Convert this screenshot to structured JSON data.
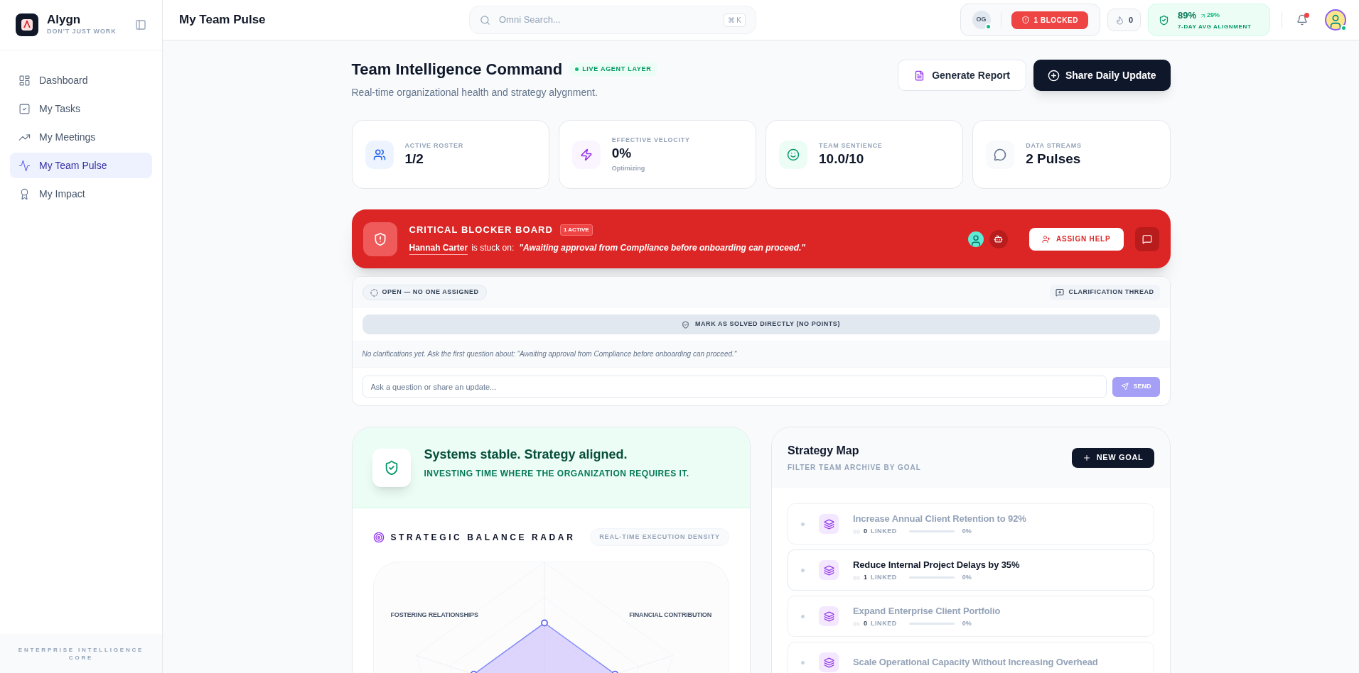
{
  "brand": {
    "name": "Alygn",
    "tagline": "DON'T JUST WORK"
  },
  "sidebar": {
    "items": [
      {
        "label": "Dashboard",
        "selected": false
      },
      {
        "label": "My Tasks",
        "selected": false
      },
      {
        "label": "My Meetings",
        "selected": false
      },
      {
        "label": "My Team Pulse",
        "selected": true
      },
      {
        "label": "My Impact",
        "selected": false
      }
    ],
    "footer": "ENTERPRISE INTELLIGENCE CORE"
  },
  "topbar": {
    "title": "My Team Pulse",
    "search": {
      "placeholder": "Omni Search...",
      "shortcut": "⌘ K"
    },
    "user_initials": "OG",
    "user_online": true,
    "blocked_badge": "1 BLOCKED",
    "streak": "0",
    "alignment": {
      "value": "89%",
      "delta": "29%",
      "label": "7-DAY AVG ALIGNMENT"
    },
    "notifications_unread": true,
    "avatar_online": true
  },
  "header": {
    "title": "Team Intelligence Command",
    "live_badge": "LIVE AGENT LAYER",
    "subtitle": "Real-time organizational health and strategy alygnment.",
    "buttons": [
      {
        "label": "Generate Report",
        "kind": "secondary"
      },
      {
        "label": "Share Daily Update",
        "kind": "primary"
      }
    ]
  },
  "stats": [
    {
      "label": "ACTIVE ROSTER",
      "value": "1/2"
    },
    {
      "label": "EFFECTIVE VELOCITY",
      "value": "0%",
      "note": "Optimizing"
    },
    {
      "label": "TEAM SENTIENCE",
      "value": "10.0/10"
    },
    {
      "label": "DATA STREAMS",
      "value": "2 Pulses"
    }
  ],
  "blocker": {
    "title": "CRITICAL BLOCKER BOARD",
    "badge": "1 ACTIVE",
    "person": "Hannah Carter",
    "stuck_text": "is stuck on:",
    "quote": "\"Awaiting approval from Compliance before onboarding can proceed.\"",
    "assign_button": "ASSIGN HELP"
  },
  "thread": {
    "status": "OPEN — NO ONE ASSIGNED",
    "thread_label": "CLARIFICATION THREAD",
    "solve_button": "MARK AS SOLVED DIRECTLY (NO POINTS)",
    "empty_note": "No clarifications yet. Ask the first question about: \"Awaiting approval from Compliance before onboarding can proceed.\"",
    "input": {
      "placeholder": "Ask a question or share an update..."
    },
    "send": {
      "label": "SEND",
      "disabled": true
    }
  },
  "health": {
    "title": "Systems stable. Strategy aligned.",
    "subtitle": "INVESTING TIME WHERE THE ORGANIZATION REQUIRES IT.",
    "radar_title": "STRATEGIC BALANCE RADAR",
    "radar_badge": "REAL-TIME EXECUTION DENSITY",
    "axis_labels": [
      "FOSTERING RELATIONSHIPS",
      "FINANCIAL CONTRIBUTION"
    ]
  },
  "strategy": {
    "title": "Strategy Map",
    "subtitle": "FILTER TEAM ARCHIVE BY GOAL",
    "new_button": "NEW GOAL",
    "goals": [
      {
        "title": "Increase Annual Client Retention to 92%",
        "linked_count": "0",
        "linked_label": "LINKED",
        "level": 0,
        "percent": "0%",
        "selected": false
      },
      {
        "title": "Reduce Internal Project Delays by 35%",
        "linked_count": "1",
        "linked_label": "LINKED",
        "level": 0,
        "percent": "0%",
        "selected": true
      },
      {
        "title": "Expand Enterprise Client Portfolio",
        "linked_count": "0",
        "linked_label": "LINKED",
        "level": 0,
        "percent": "0%",
        "selected": false
      },
      {
        "title": "Scale Operational Capacity Without Increasing Overhead",
        "selected": false
      }
    ]
  }
}
